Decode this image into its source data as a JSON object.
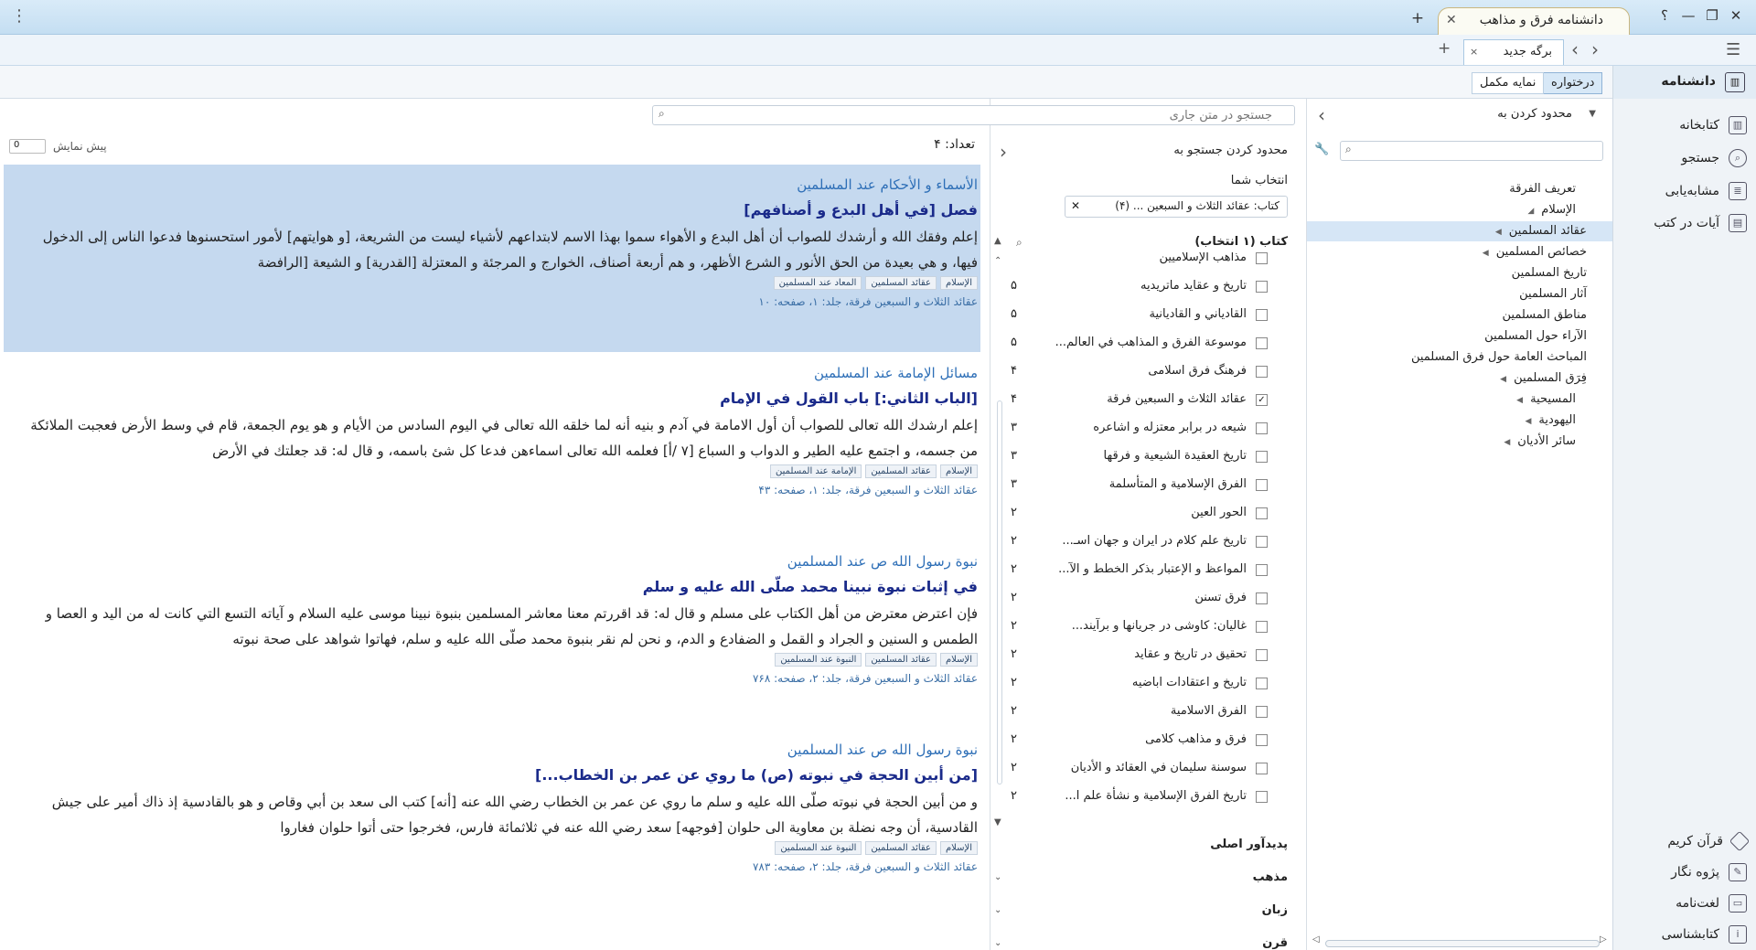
{
  "window": {
    "title": "دانشنامه فرق و مذاهب",
    "add_tab": "+",
    "help": "؟",
    "minimize": "—",
    "restore": "❐",
    "close": "✕",
    "menu": "⋮"
  },
  "tabs": {
    "current": "برگه جدید",
    "add": "+",
    "back": "‹",
    "forward": "›",
    "close": "×"
  },
  "toolbar": {
    "home_label": "دانشنامه",
    "tree_view": "درختواره",
    "full_index": "نمایه مکمل"
  },
  "nav": {
    "items": [
      {
        "label": "کتابخانه",
        "icon": "library-icon"
      },
      {
        "label": "جستجو",
        "icon": "search-icon"
      },
      {
        "label": "مشابه‌یابی",
        "icon": "similar-icon"
      },
      {
        "label": "آیات در کتب",
        "icon": "verses-icon"
      }
    ],
    "bottom": [
      {
        "label": "قرآن کریم",
        "icon": "quran-icon"
      },
      {
        "label": "پژوه نگار",
        "icon": "notes-icon"
      },
      {
        "label": "لغت‌نامه",
        "icon": "dictionary-icon"
      },
      {
        "label": "کتابشناسی",
        "icon": "bibliography-icon"
      }
    ]
  },
  "tree": {
    "limit_label": "محدود کردن به",
    "search_placeholder": "",
    "items": [
      {
        "label": "تعريف الفرقة",
        "level": 0,
        "arrow": ""
      },
      {
        "label": "الإسلام",
        "level": 0,
        "arrow": "◢"
      },
      {
        "label": "عقائد المسلمين",
        "level": 1,
        "arrow": "◀",
        "selected": true
      },
      {
        "label": "خصائص المسلمين",
        "level": 1,
        "arrow": "◀"
      },
      {
        "label": "تاريخ المسلمين",
        "level": 1,
        "arrow": ""
      },
      {
        "label": "آثار المسلمين",
        "level": 1,
        "arrow": ""
      },
      {
        "label": "مناطق المسلمين",
        "level": 1,
        "arrow": ""
      },
      {
        "label": "الآراء حول المسلمين",
        "level": 1,
        "arrow": ""
      },
      {
        "label": "المباحث العامة حول فرق المسلمين",
        "level": 1,
        "arrow": ""
      },
      {
        "label": "فِرَق المسلمين",
        "level": 1,
        "arrow": "◀"
      },
      {
        "label": "المسيحية",
        "level": 0,
        "arrow": "◀"
      },
      {
        "label": "اليهودية",
        "level": 0,
        "arrow": "◀"
      },
      {
        "label": "سائر الأديان",
        "level": 0,
        "arrow": "◀"
      }
    ]
  },
  "filter": {
    "title": "محدود کردن جستجو به",
    "your_selection": "انتخاب شما",
    "chip": "کتاب: عقائد الثلاث و السبعين ... (۴)",
    "books_header": "کتاب (۱ انتخاب)",
    "top_partial": "مذاهب الإسلاميين",
    "books": [
      {
        "label": "تاریخ و عقاید ماتریدیه",
        "count": "۵",
        "checked": false
      },
      {
        "label": "القادياني و القاديانية",
        "count": "۵",
        "checked": false
      },
      {
        "label": "موسوعة الفرق و المذاهب في العالم...",
        "count": "۵",
        "checked": false
      },
      {
        "label": "فرهنگ فرق اسلامی",
        "count": "۴",
        "checked": false
      },
      {
        "label": "عقائد الثلاث و السبعين فرقة",
        "count": "۴",
        "checked": true
      },
      {
        "label": "شیعه در برابر معتزله و اشاعره",
        "count": "۳",
        "checked": false
      },
      {
        "label": "تاريخ العقيدة الشيعية و فرقها",
        "count": "۳",
        "checked": false
      },
      {
        "label": "الفرق الإسلامية و المتأسلمة",
        "count": "۳",
        "checked": false
      },
      {
        "label": "الحور العين",
        "count": "۲",
        "checked": false
      },
      {
        "label": "تاریخ علم کلام در ایران و جهان اسـ...",
        "count": "۲",
        "checked": false
      },
      {
        "label": "المواعظ و الإعتبار بذكر الخطط و الآ...",
        "count": "۲",
        "checked": false
      },
      {
        "label": "فرق تسنن",
        "count": "۲",
        "checked": false
      },
      {
        "label": "غالیان: کاوشی در جریانها و برآیند...",
        "count": "۲",
        "checked": false
      },
      {
        "label": "تحقیق در تاریخ و عقاید",
        "count": "۲",
        "checked": false
      },
      {
        "label": "تاریخ و اعتقادات اباضیه",
        "count": "۲",
        "checked": false
      },
      {
        "label": "الفرق الاسلامية",
        "count": "۲",
        "checked": false
      },
      {
        "label": "فرق و مذاهب کلامی",
        "count": "۲",
        "checked": false
      },
      {
        "label": "سوسنة سليمان في العقائد و الأديان",
        "count": "۲",
        "checked": false
      },
      {
        "label": "تاريخ الفرق الإسلامية و نشأة علم ا...",
        "count": "۲",
        "checked": false
      }
    ],
    "sections": [
      "پدیدآور اصلی",
      "مذهب",
      "زبان",
      "قرن"
    ]
  },
  "results": {
    "search_placeholder": "جستجو در متن جاری",
    "count_label": "تعداد: ۴",
    "preview_label": "پیش نمایش",
    "preview_value": "0",
    "items": [
      {
        "category": "الأسماء و الأحكام عند المسلمين",
        "title": "فصل [في أهل البدع و أصنافهم]",
        "line1": "إعلم وفقك الله و أرشدك للصواب أن أهل البدع و الأهواء سموا بهذا الاسم لابتداعهم لأشياء ليست من الشريعة، [و هوايتهم] لأمور استحسنوها فدعوا الناس إلى الدخول",
        "line2": "فيها، و هي بعيدة من الحق الأنور و الشرع الأظهر، و هم أربعة أصناف، الخوارج و المرجئة و المعتزلة [القدرية] و الشيعة [الرافضة",
        "tags": [
          "الإسلام",
          "عقائد المسلمين",
          "المعاد عند المسلمين"
        ],
        "source": "عقائد الثلاث و السبعين فرقة، جلد: ۱، صفحه: ۱۰"
      },
      {
        "category": "مسائل الإمامة عند المسلمين",
        "title": "[الباب الثاني:] باب القول في الإمام",
        "line1": "إعلم ارشدك الله تعالى للصواب أن أول الامامة في آدم و بنيه أنه لما خلقه الله تعالى في اليوم السادس من الأيام و هو يوم الجمعة، قام في وسط الأرض فعجبت الملائكة",
        "line2": "من جسمه، و اجتمع عليه الطير و الدواب و السباع [۷ /أ] فعلمه الله تعالى اسماءهن فدعا كل شئ باسمه، و قال له: قد جعلتك في الأرض",
        "tags": [
          "الإسلام",
          "عقائد المسلمين",
          "الإمامة عند المسلمين"
        ],
        "source": "عقائد الثلاث و السبعين فرقة، جلد: ۱، صفحه: ۴۳"
      },
      {
        "category": "نبوة رسول الله ص عند المسلمين",
        "title": "في إثبات نبوة نبينا محمد صلّى الله عليه و سلم",
        "line1": "فإن اعترض معترض من أهل الكتاب على مسلم و قال له: قد اقررتم معنا معاشر المسلمين بنبوة نبينا موسى عليه السلام و آياته التسع التي كانت له من اليد و العصا و",
        "line2": "الطمس و السنين و الجراد و القمل و الضفادع و الدم، و نحن لم نقر بنبوة محمد صلّى الله عليه و سلم، فهاتوا شواهد على صحة نبوته",
        "tags": [
          "الإسلام",
          "عقائد المسلمين",
          "النبوة عند المسلمين"
        ],
        "source": "عقائد الثلاث و السبعين فرقة، جلد: ۲، صفحه: ۷۶۸"
      },
      {
        "category": "نبوة رسول الله ص عند المسلمين",
        "title": "[من أبين الحجة في نبوته (ص) ما روي عن عمر بن الخطاب...]",
        "line1": "و من أبين الحجة في نبوته صلّى الله عليه و سلم ما روي عن عمر بن الخطاب رضي الله عنه [أنه] كتب الى سعد بن أبي وقاص و هو بالقادسية إذ ذاك أمير على جيش",
        "line2": "القادسية، أن وجه نضلة بن معاوية الى حلوان [فوجهه] سعد رضي الله عنه في ثلاثمائة فارس، فخرجوا حتى أتوا حلوان فغاروا",
        "tags": [
          "الإسلام",
          "عقائد المسلمين",
          "النبوة عند المسلمين"
        ],
        "source": "عقائد الثلاث و السبعين فرقة، جلد: ۲، صفحه: ۷۸۳"
      }
    ]
  },
  "colors": {
    "accent": "#2e6fb7",
    "selection": "#c5d9ef",
    "title": "#1a2a8a"
  }
}
